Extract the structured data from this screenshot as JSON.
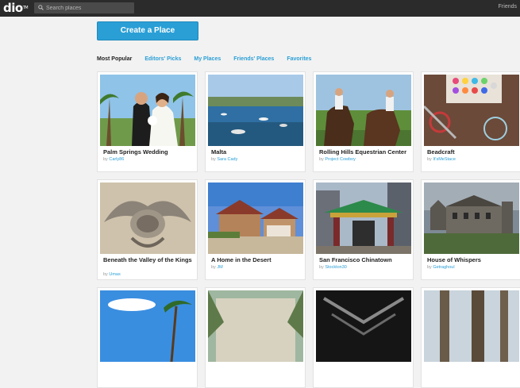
{
  "topbar": {
    "logo": "dio",
    "logo_mark": "TM",
    "search_placeholder": "Search places",
    "friends_label": "Friends"
  },
  "create_button": "Create a Place",
  "tabs": [
    {
      "label": "Most Popular",
      "active": true
    },
    {
      "label": "Editors' Picks",
      "active": false
    },
    {
      "label": "My Places",
      "active": false
    },
    {
      "label": "Friends' Places",
      "active": false
    },
    {
      "label": "Favorites",
      "active": false
    }
  ],
  "by_prefix": "by",
  "places": [
    {
      "title": "Palm Springs Wedding",
      "author": "Carly86"
    },
    {
      "title": "Malta",
      "author": "Sara Cady"
    },
    {
      "title": "Rolling Hills Equestrian Center",
      "author": "Project Cowboy"
    },
    {
      "title": "Beadcraft",
      "author": "It'sMeStace"
    },
    {
      "title": "Beneath the Valley of the Kings",
      "author": "Umas"
    },
    {
      "title": "A Home in the Desert",
      "author": "JM"
    },
    {
      "title": "San Francisco Chinatown",
      "author": "Stockton30"
    },
    {
      "title": "House of Whispers",
      "author": "Getraghoul"
    },
    {
      "title": "",
      "author": ""
    },
    {
      "title": "",
      "author": ""
    },
    {
      "title": "",
      "author": ""
    },
    {
      "title": "",
      "author": ""
    }
  ]
}
